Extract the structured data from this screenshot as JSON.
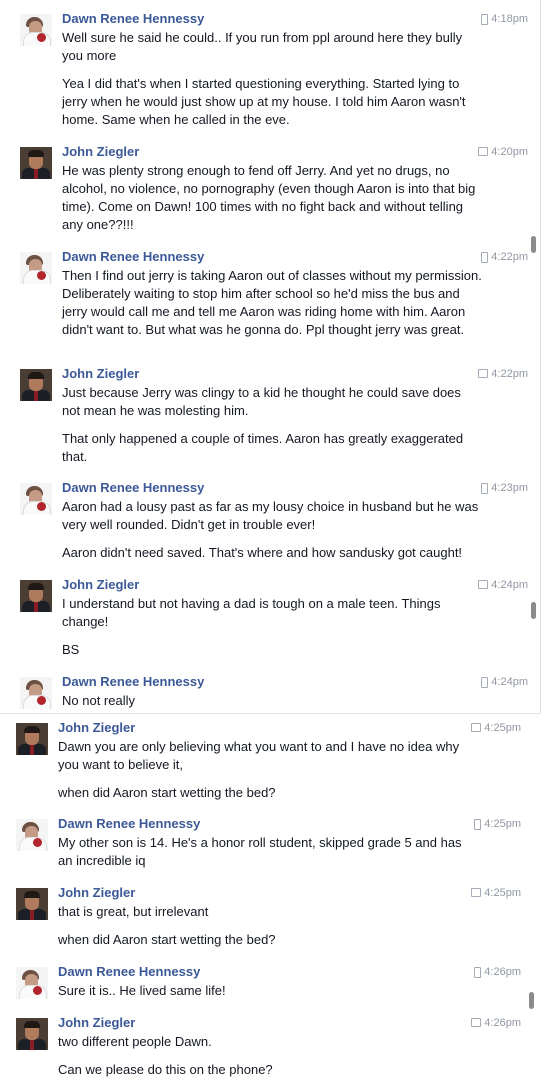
{
  "panel1": {
    "messages": [
      {
        "sender": "Dawn Renee Hennessy",
        "time": "4:18pm",
        "source": "mobile",
        "avatar": "dawn-avatar",
        "paragraphs": [
          "Well sure he said he could.. If you run from ppl around here they bully you more",
          "Yea I did that's when I started questioning everything. Started lying to jerry when he would just show up at my house. I told him Aaron wasn't home. Same when he called in the eve."
        ]
      },
      {
        "sender": "John Ziegler",
        "time": "4:20pm",
        "source": "chat",
        "avatar": "john-avatar",
        "paragraphs": [
          "He was plenty strong enough to fend off Jerry. And yet no drugs, no alcohol, no violence, no pornography (even though Aaron is into that big time). Come on Dawn! 100 times with no fight back and without telling any one??!!!"
        ]
      },
      {
        "sender": "Dawn Renee Hennessy",
        "time": "4:22pm",
        "source": "mobile",
        "avatar": "dawn-avatar",
        "paragraphs": [
          "Then I find out jerry is taking Aaron out of classes without my permission. Deliberately waiting to stop him after school so he'd miss the bus and jerry would call me and tell me Aaron was riding home with him. Aaron didn't want to. But what was he gonna do. Ppl thought jerry was great."
        ]
      },
      {
        "sender": "John Ziegler",
        "time": "4:22pm",
        "source": "chat",
        "avatar": "john-avatar",
        "paragraphs": [
          "Just because Jerry was clingy to a kid he thought he could save does not mean he was molesting him.",
          "That only happened a couple of times. Aaron has greatly exaggerated that."
        ]
      },
      {
        "sender": "Dawn Renee Hennessy",
        "time": "4:23pm",
        "source": "mobile",
        "avatar": "dawn-avatar",
        "paragraphs": [
          "Aaron had a lousy past as far as my lousy choice in husband but he was very well rounded. Didn't get in trouble ever!",
          "Aaron didn't need saved. That's where and how sandusky got caught!"
        ]
      },
      {
        "sender": "John Ziegler",
        "time": "4:24pm",
        "source": "chat",
        "avatar": "john-avatar",
        "paragraphs": [
          "I understand but not having a dad is tough on a male teen. Things change!",
          "BS"
        ]
      },
      {
        "sender": "Dawn Renee Hennessy",
        "time": "4:24pm",
        "source": "mobile",
        "avatar": "dawn-avatar",
        "paragraphs": [
          "No not really"
        ]
      }
    ]
  },
  "panel2": {
    "messages": [
      {
        "sender": "John Ziegler",
        "time": "4:25pm",
        "source": "chat",
        "avatar": "john-avatar",
        "paragraphs": [
          "Dawn you are only believing what you want to and I have no idea why you want to believe it,",
          "when did Aaron start wetting the bed?"
        ]
      },
      {
        "sender": "Dawn Renee Hennessy",
        "time": "4:25pm",
        "source": "mobile",
        "avatar": "dawn-avatar",
        "paragraphs": [
          "My other son is 14. He's a honor roll student, skipped grade 5 and has an incredible iq"
        ]
      },
      {
        "sender": "John Ziegler",
        "time": "4:25pm",
        "source": "chat",
        "avatar": "john-avatar",
        "paragraphs": [
          "that is great, but irrelevant",
          "when did Aaron start wetting the bed?"
        ]
      },
      {
        "sender": "Dawn Renee Hennessy",
        "time": "4:26pm",
        "source": "mobile",
        "avatar": "dawn-avatar",
        "paragraphs": [
          "Sure it is.. He lived same life!"
        ]
      },
      {
        "sender": "John Ziegler",
        "time": "4:26pm",
        "source": "chat",
        "avatar": "john-avatar",
        "paragraphs": [
          "two different people Dawn.",
          "Can we please do this on the phone?"
        ]
      }
    ]
  }
}
